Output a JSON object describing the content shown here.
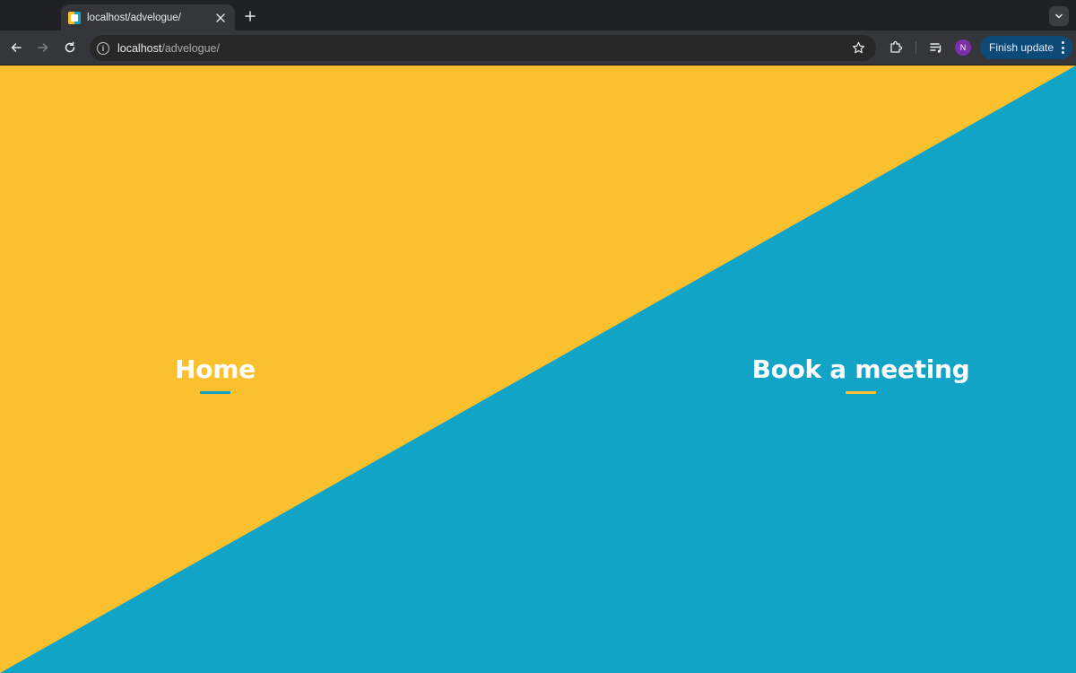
{
  "browser": {
    "tab": {
      "title": "localhost/advelogue/",
      "favicon": "advelogue-favicon-icon"
    },
    "address_bar": {
      "host": "localhost",
      "path": "/advelogue/"
    },
    "profile_initial": "N",
    "update_button_label": "Finish update",
    "icons": {
      "new_tab": "plus-icon",
      "tab_close": "close-icon",
      "tab_search": "chevron-down-icon",
      "back": "arrow-left-icon",
      "forward": "arrow-right-icon",
      "reload": "reload-icon",
      "site_info": "info-icon",
      "bookmark": "star-icon",
      "extensions": "puzzle-icon",
      "media": "media-queue-icon",
      "menu": "kebab-menu-icon"
    }
  },
  "page": {
    "colors": {
      "yellow": "#fbc02d",
      "blue": "#12a4c7"
    },
    "links": {
      "home": "Home",
      "book_meeting": "Book a meeting"
    }
  }
}
